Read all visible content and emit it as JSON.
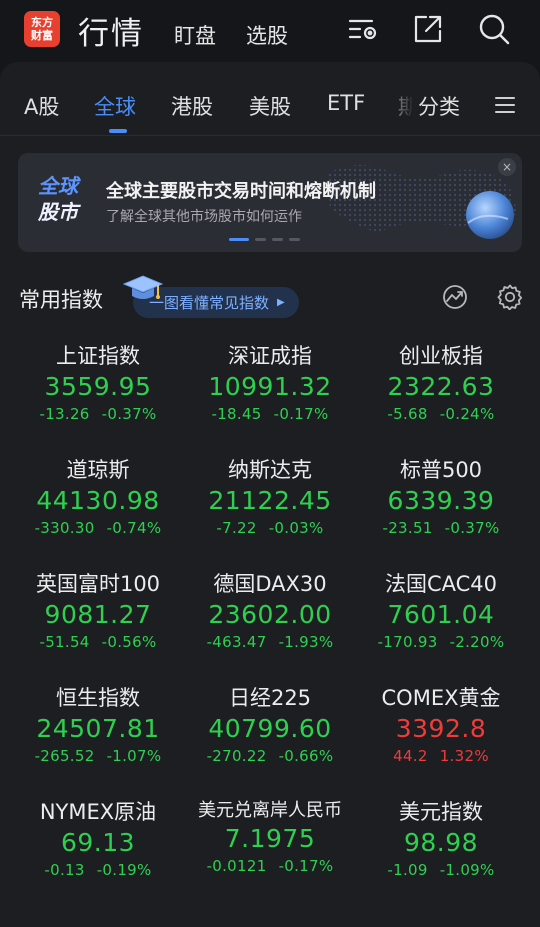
{
  "header": {
    "logo_line1": "东方",
    "logo_line2": "财富",
    "title": "行情",
    "links": [
      "盯盘",
      "选股"
    ]
  },
  "tabs": [
    {
      "label": "A股",
      "active": false
    },
    {
      "label": "全球",
      "active": true
    },
    {
      "label": "港股",
      "active": false
    },
    {
      "label": "美股",
      "active": false
    },
    {
      "label": "ETF",
      "active": false
    },
    {
      "label": "期",
      "active": false
    },
    {
      "label": "分类",
      "active": false
    }
  ],
  "banner": {
    "badge_line1": "全球",
    "badge_line2": "股市",
    "title": "全球主要股市交易时间和熔断机制",
    "subtitle": "了解全球其他市场股市如何运作",
    "close": "×",
    "page_count": 4,
    "active_page": 1
  },
  "section": {
    "title": "常用指数",
    "guide_link": "一图看懂常见指数"
  },
  "colors": {
    "down": "#2fd050",
    "up": "#f03b3b",
    "accent": "#4a8df8"
  },
  "indices": [
    {
      "name": "上证指数",
      "price": "3559.95",
      "change": "-13.26",
      "pct": "-0.37%",
      "dir": "down"
    },
    {
      "name": "深证成指",
      "price": "10991.32",
      "change": "-18.45",
      "pct": "-0.17%",
      "dir": "down"
    },
    {
      "name": "创业板指",
      "price": "2322.63",
      "change": "-5.68",
      "pct": "-0.24%",
      "dir": "down"
    },
    {
      "name": "道琼斯",
      "price": "44130.98",
      "change": "-330.30",
      "pct": "-0.74%",
      "dir": "down"
    },
    {
      "name": "纳斯达克",
      "price": "21122.45",
      "change": "-7.22",
      "pct": "-0.03%",
      "dir": "down"
    },
    {
      "name": "标普500",
      "price": "6339.39",
      "change": "-23.51",
      "pct": "-0.37%",
      "dir": "down"
    },
    {
      "name": "英国富时100",
      "price": "9081.27",
      "change": "-51.54",
      "pct": "-0.56%",
      "dir": "down"
    },
    {
      "name": "德国DAX30",
      "price": "23602.00",
      "change": "-463.47",
      "pct": "-1.93%",
      "dir": "down"
    },
    {
      "name": "法国CAC40",
      "price": "7601.04",
      "change": "-170.93",
      "pct": "-2.20%",
      "dir": "down"
    },
    {
      "name": "恒生指数",
      "price": "24507.81",
      "change": "-265.52",
      "pct": "-1.07%",
      "dir": "down"
    },
    {
      "name": "日经225",
      "price": "40799.60",
      "change": "-270.22",
      "pct": "-0.66%",
      "dir": "down"
    },
    {
      "name": "COMEX黄金",
      "price": "3392.8",
      "change": "44.2",
      "pct": "1.32%",
      "dir": "up"
    },
    {
      "name": "NYMEX原油",
      "price": "69.13",
      "change": "-0.13",
      "pct": "-0.19%",
      "dir": "down"
    },
    {
      "name": "美元兑离岸人民币",
      "price": "7.1975",
      "change": "-0.0121",
      "pct": "-0.17%",
      "dir": "down"
    },
    {
      "name": "美元指数",
      "price": "98.98",
      "change": "-1.09",
      "pct": "-1.09%",
      "dir": "down"
    }
  ]
}
